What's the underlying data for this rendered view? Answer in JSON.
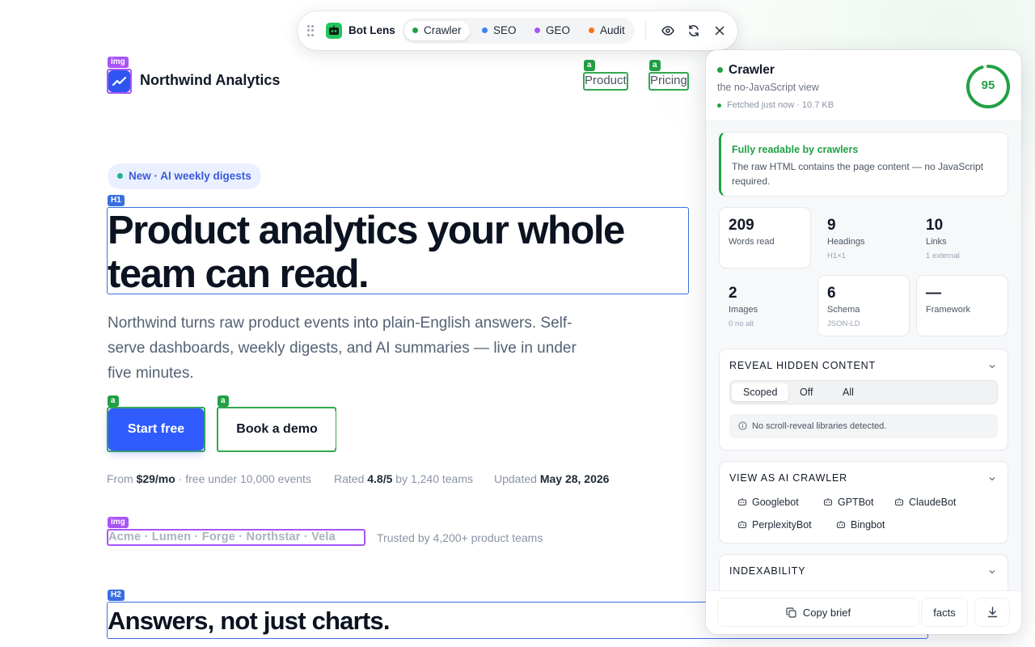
{
  "site": {
    "brand": "Northwind Analytics",
    "nav": [
      "Product",
      "Pricing"
    ],
    "badge": "New · AI weekly digests",
    "headline": "Product analytics your whole team can read.",
    "lede": "Northwind turns raw product events into plain-English answers. Self-serve dashboards, weekly digests, and AI summaries — live in under five minutes.",
    "cta_primary": "Start free",
    "cta_secondary": "Book a demo",
    "meta": {
      "price_prefix": "From",
      "price": "$29/mo",
      "price_suffix": "· free under 10,000 events",
      "rating_prefix": "Rated",
      "rating": "4.8/5",
      "rating_suffix": "by 1,240 teams",
      "updated_prefix": "Updated",
      "updated": "May 28, 2026"
    },
    "logos": "Acme · Lumen · Forge · Northstar · Vela",
    "trusted": "Trusted by 4,200+ product teams",
    "subheadline": "Answers, not just charts."
  },
  "overlay_tags": {
    "img": "img",
    "a": "a",
    "h1": "H1",
    "h2": "H2"
  },
  "toolbar": {
    "name": "Bot Lens",
    "modes": [
      {
        "label": "Crawler",
        "color": "#22a045"
      },
      {
        "label": "SEO",
        "color": "#3b82f6"
      },
      {
        "label": "GEO",
        "color": "#a855f7"
      },
      {
        "label": "Audit",
        "color": "#f97316"
      }
    ],
    "icons": [
      "eye-icon",
      "refresh-icon",
      "close-icon"
    ]
  },
  "panel": {
    "title": "Crawler",
    "subtitle": "the no-JavaScript view",
    "fetched": "Fetched just now · 10.7 KB",
    "score": 95,
    "score_max": 100,
    "readable_title": "Fully readable by crawlers",
    "readable_text": "The raw HTML contains the page content — no JavaScript required.",
    "stats": [
      {
        "value": "209",
        "label": "Words read",
        "sub": ""
      },
      {
        "value": "9",
        "label": "Headings",
        "sub": "H1×1"
      },
      {
        "value": "10",
        "label": "Links",
        "sub": "1 external"
      },
      {
        "value": "2",
        "label": "Images",
        "sub": "0 no alt"
      },
      {
        "value": "6",
        "label": "Schema",
        "sub": "JSON-LD"
      },
      {
        "value": "—",
        "label": "Framework",
        "sub": ""
      }
    ],
    "reveal": {
      "heading": "REVEAL HIDDEN CONTENT",
      "options": [
        "Scoped",
        "Off",
        "All"
      ],
      "selected": "Scoped",
      "note": "No scroll-reveal libraries detected."
    },
    "view_as": {
      "heading": "VIEW AS AI CRAWLER",
      "bots": [
        "Googlebot",
        "GPTBot",
        "ClaudeBot",
        "PerplexityBot",
        "Bingbot"
      ]
    },
    "indexability": {
      "heading": "INDEXABILITY"
    },
    "footer": {
      "copy": "Copy brief",
      "facts": "facts"
    }
  },
  "colors": {
    "accent": "#2f5bff",
    "success": "#22a045",
    "tag_img": "#a855f7",
    "tag_link": "#34a853",
    "tag_heading": "#3b6fe0"
  }
}
